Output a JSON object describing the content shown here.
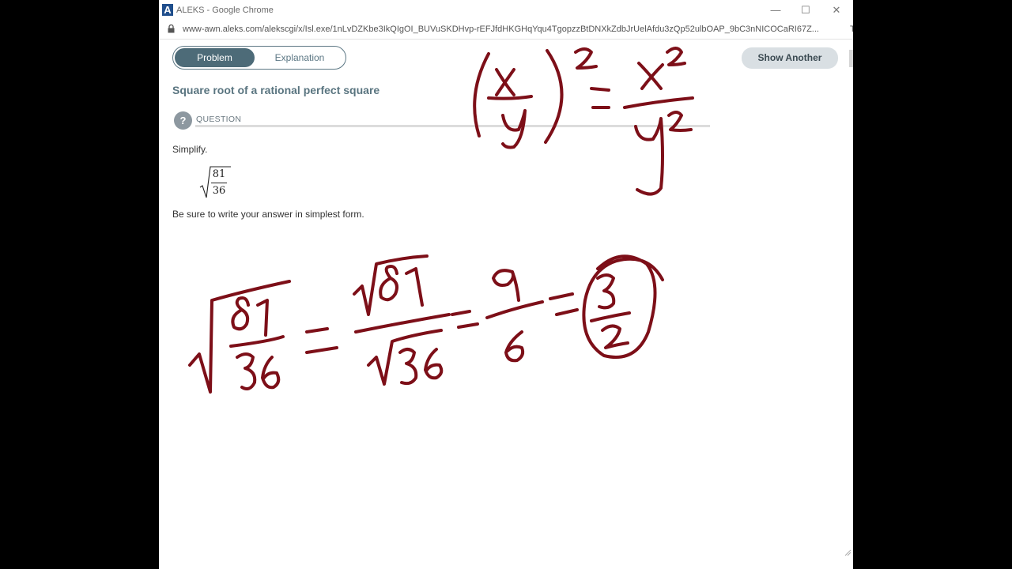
{
  "window": {
    "title": "ALEKS - Google Chrome",
    "app_icon_letter": "A",
    "controls": {
      "minimize": "—",
      "maximize": "☐",
      "close": "✕"
    }
  },
  "browser": {
    "url": "www-awn.aleks.com/alekscgi/x/Isl.exe/1nLvDZKbe3IkQIgOI_BUVuSKDHvp-rEFJfdHKGHqYqu4TgopzzBtDNXkZdbJrUelAfdu3zQp52ulbOAP_9bC3nNICOCaRI67Z...",
    "url_trailing": "T"
  },
  "tabs": {
    "problem": "Problem",
    "explanation": "Explanation"
  },
  "toolbar": {
    "show_another": "Show Another"
  },
  "question": {
    "heading": "Square root of a rational perfect square",
    "section_label": "QUESTION",
    "icon_glyph": "?",
    "prompt": "Simplify.",
    "numerator": "81",
    "denominator": "36",
    "instruction": "Be sure to write your answer in simplest form."
  },
  "colors": {
    "ink": "#7d0f18",
    "tab_active": "#4d6b78",
    "heading": "#5a7580"
  }
}
